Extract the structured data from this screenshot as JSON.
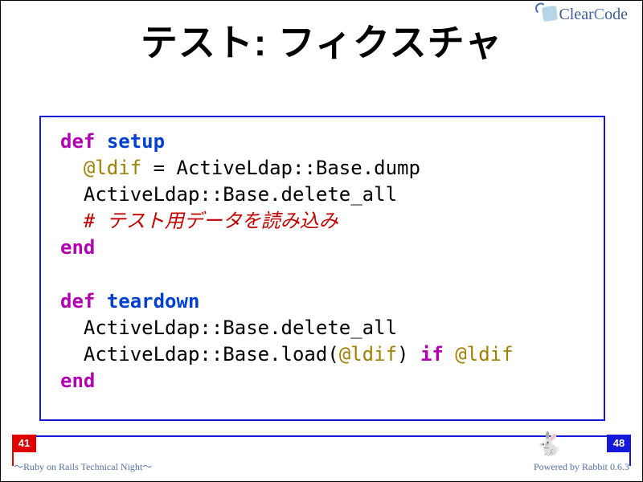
{
  "title": "テスト: フィクスチャ",
  "logo": {
    "text1": "Clear",
    "text2": "C",
    "text3": "ode"
  },
  "code": {
    "l1_kw": "def",
    "l1_name": "setup",
    "l2_ivar": "@ldif",
    "l2_rest": " = ActiveLdap::Base.dump",
    "l3": "  ActiveLdap::Base.delete_all",
    "l4_comment": "# テスト用データを読み込み",
    "l5_kw": "end",
    "l7_kw": "def",
    "l7_name": "teardown",
    "l8": "  ActiveLdap::Base.delete_all",
    "l9_a": "  ActiveLdap::Base.load(",
    "l9_ivar1": "@ldif",
    "l9_b": ") ",
    "l9_kw": "if",
    "l9_sp": " ",
    "l9_ivar2": "@ldif",
    "l10_kw": "end"
  },
  "pager": {
    "current": "41",
    "total": "48"
  },
  "footer": {
    "left": "〜Ruby on Rails Technical Night〜",
    "right": "Powered by Rabbit 0.6.3"
  }
}
